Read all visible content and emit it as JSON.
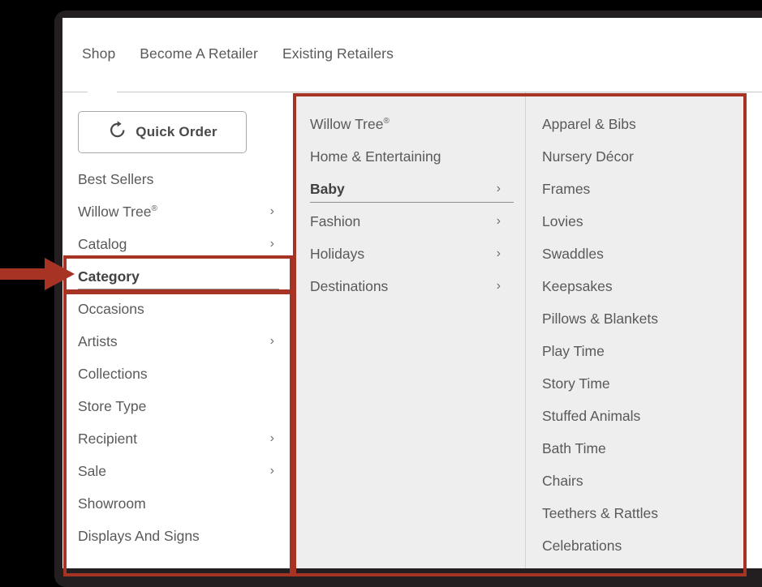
{
  "annotation": {
    "color": "#a63324",
    "arrow_icon": "right-arrow-annotation",
    "boxes": [
      "category-row",
      "sidebar-category-list",
      "mega-menu-panel"
    ]
  },
  "frame": {
    "bezel_color": "#231f20",
    "page_background": "#ffffff",
    "mega_background": "#eeeeee"
  },
  "topnav": {
    "items": [
      {
        "label": "Shop"
      },
      {
        "label": "Become A Retailer"
      },
      {
        "label": "Existing Retailers"
      }
    ],
    "active_index": 0
  },
  "sidebar": {
    "quick_order": {
      "label": "Quick Order",
      "icon": "refresh-circular-arrow-icon"
    },
    "items": [
      {
        "label": "Best Sellers",
        "sup": "",
        "chevron": false,
        "active": false
      },
      {
        "label": "Willow Tree",
        "sup": "®",
        "chevron": true,
        "active": false
      },
      {
        "label": "Catalog",
        "sup": "",
        "chevron": true,
        "active": false
      },
      {
        "label": "Category",
        "sup": "",
        "chevron": false,
        "active": true
      },
      {
        "label": "Occasions",
        "sup": "",
        "chevron": false,
        "active": false
      },
      {
        "label": "Artists",
        "sup": "",
        "chevron": true,
        "active": false
      },
      {
        "label": "Collections",
        "sup": "",
        "chevron": false,
        "active": false
      },
      {
        "label": "Store Type",
        "sup": "",
        "chevron": false,
        "active": false
      },
      {
        "label": "Recipient",
        "sup": "",
        "chevron": true,
        "active": false
      },
      {
        "label": "Sale",
        "sup": "",
        "chevron": true,
        "active": false
      },
      {
        "label": "Showroom",
        "sup": "",
        "chevron": false,
        "active": false
      },
      {
        "label": "Displays And Signs",
        "sup": "",
        "chevron": false,
        "active": false
      }
    ]
  },
  "mega": {
    "column_a": [
      {
        "label": "Willow Tree",
        "sup": "®",
        "chevron": false,
        "active": false
      },
      {
        "label": "Home & Entertaining",
        "sup": "",
        "chevron": false,
        "active": false
      },
      {
        "label": "Baby",
        "sup": "",
        "chevron": true,
        "active": true
      },
      {
        "label": "Fashion",
        "sup": "",
        "chevron": true,
        "active": false
      },
      {
        "label": "Holidays",
        "sup": "",
        "chevron": true,
        "active": false
      },
      {
        "label": "Destinations",
        "sup": "",
        "chevron": true,
        "active": false
      }
    ],
    "column_b": [
      {
        "label": "Apparel & Bibs",
        "sup": "",
        "chevron": false,
        "active": false
      },
      {
        "label": "Nursery Décor",
        "sup": "",
        "chevron": false,
        "active": false
      },
      {
        "label": "Frames",
        "sup": "",
        "chevron": false,
        "active": false
      },
      {
        "label": "Lovies",
        "sup": "",
        "chevron": false,
        "active": false
      },
      {
        "label": "Swaddles",
        "sup": "",
        "chevron": false,
        "active": false
      },
      {
        "label": "Keepsakes",
        "sup": "",
        "chevron": false,
        "active": false
      },
      {
        "label": "Pillows & Blankets",
        "sup": "",
        "chevron": false,
        "active": false
      },
      {
        "label": "Play Time",
        "sup": "",
        "chevron": false,
        "active": false
      },
      {
        "label": "Story Time",
        "sup": "",
        "chevron": false,
        "active": false
      },
      {
        "label": "Stuffed Animals",
        "sup": "",
        "chevron": false,
        "active": false
      },
      {
        "label": "Bath Time",
        "sup": "",
        "chevron": false,
        "active": false
      },
      {
        "label": "Chairs",
        "sup": "",
        "chevron": false,
        "active": false
      },
      {
        "label": "Teethers & Rattles",
        "sup": "",
        "chevron": false,
        "active": false
      },
      {
        "label": "Celebrations",
        "sup": "",
        "chevron": false,
        "active": false
      }
    ]
  },
  "chevron_glyph": "›"
}
